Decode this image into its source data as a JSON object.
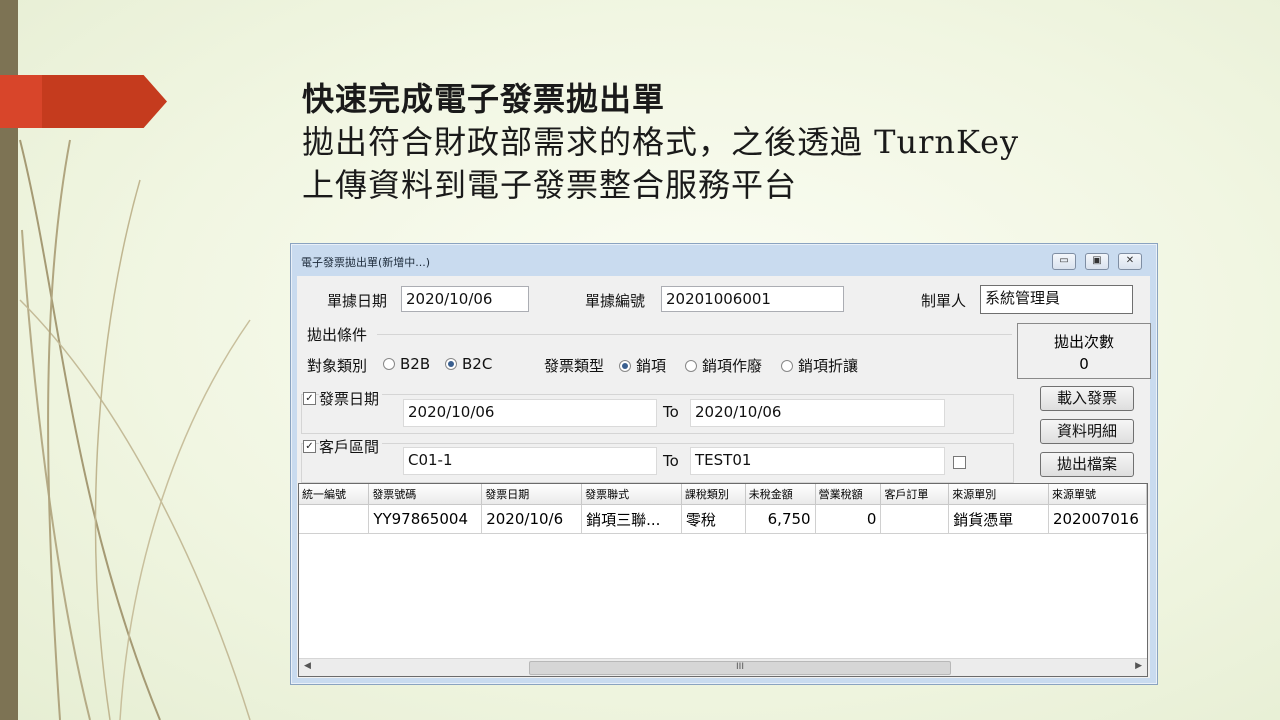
{
  "slide": {
    "title_line1": "快速完成電子發票拋出單",
    "title_line2": "拋出符合財政部需求的格式，之後透過 TurnKey",
    "title_line3": "上傳資料到電子發票整合服務平台",
    "accent_color": "#c53b1e"
  },
  "window": {
    "title": "電子發票拋出單(新增中...)",
    "buttons": {
      "minimize": "▭",
      "maximize": "▣",
      "close": "✕"
    }
  },
  "form": {
    "doc_date_label": "單據日期",
    "doc_date_value": "2020/10/06",
    "doc_no_label": "單據編號",
    "doc_no_value": "20201006001",
    "creator_label": "制單人",
    "creator_value": "系統管理員",
    "conditions_label": "拋出條件",
    "target_type_label": "對象類別",
    "target_options": [
      "B2B",
      "B2C"
    ],
    "invoice_type_label": "發票類型",
    "invoice_type_options": [
      "銷項",
      "銷項作廢",
      "銷項折讓"
    ],
    "invoice_date_label": "發票日期",
    "invoice_date_from": "2020/10/06",
    "invoice_date_to": "2020/10/06",
    "customer_range_label": "客戶區間",
    "customer_from": "C01-1",
    "customer_to": "TEST01",
    "to_label": "To",
    "checked_mark": "✓"
  },
  "count": {
    "label": "拋出次數",
    "value": "0"
  },
  "actions": {
    "load": "載入發票",
    "detail": "資料明細",
    "export": "拋出檔案"
  },
  "grid": {
    "columns": [
      "統一編號",
      "發票號碼",
      "發票日期",
      "發票聯式",
      "課稅類別",
      "未稅金額",
      "營業稅額",
      "客戶訂單",
      "來源單別",
      "來源單號"
    ],
    "rows": [
      [
        "",
        "YY97865004",
        "2020/10/6",
        "銷項三聯...",
        "零稅",
        "6,750",
        "0",
        "",
        "銷貨憑單",
        "202007016"
      ]
    ],
    "scroll_thumb": "III"
  }
}
